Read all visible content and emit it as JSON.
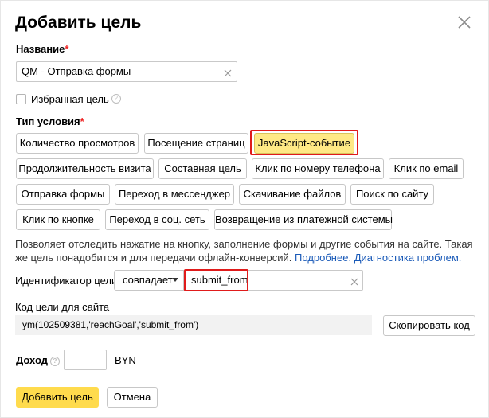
{
  "dialog": {
    "title": "Добавить цель",
    "close_icon": "close-icon"
  },
  "name_field": {
    "label": "Название",
    "required_mark": "*",
    "value": "QM - Отправка формы"
  },
  "favorite": {
    "label": "Избранная цель",
    "checked": false,
    "help_glyph": "?"
  },
  "condition": {
    "label": "Тип условия",
    "required_mark": "*",
    "selected": "JavaScript-событие",
    "buttons": [
      "Количество просмотров",
      "Посещение страниц",
      "JavaScript-событие",
      "Продолжительность визита",
      "Составная цель",
      "Клик по номеру телефона",
      "Клик по email",
      "Отправка формы",
      "Переход в мессенджер",
      "Скачивание файлов",
      "Поиск по сайту",
      "Клик по кнопке",
      "Переход в соц. сеть",
      "Возвращение из платежной системы"
    ]
  },
  "description": {
    "text": "Позволяет отследить нажатие на кнопку, заполнение формы и другие события на сайте. Такая же цель понадобится и для передачи офлайн-конверсий. ",
    "link_more": "Подробнее.",
    "link_diag": "Диагностика проблем."
  },
  "goal_id": {
    "label": "Идентификатор цели:",
    "match_select": "совпадает",
    "value": "submit_from"
  },
  "goal_code": {
    "label": "Код цели для сайта",
    "code": "ym(102509381,'reachGoal','submit_from')",
    "copy_button": "Скопировать код"
  },
  "income": {
    "label": "Доход",
    "help_glyph": "?",
    "value": "",
    "currency": "BYN"
  },
  "footer": {
    "add_button": "Добавить цель",
    "cancel_button": "Отмена"
  },
  "colors": {
    "selected_button": "#ffe985",
    "primary_button": "#ffdb4d",
    "highlight_outline": "#e01b1b",
    "link": "#1a5ab8",
    "required": "#e22"
  }
}
